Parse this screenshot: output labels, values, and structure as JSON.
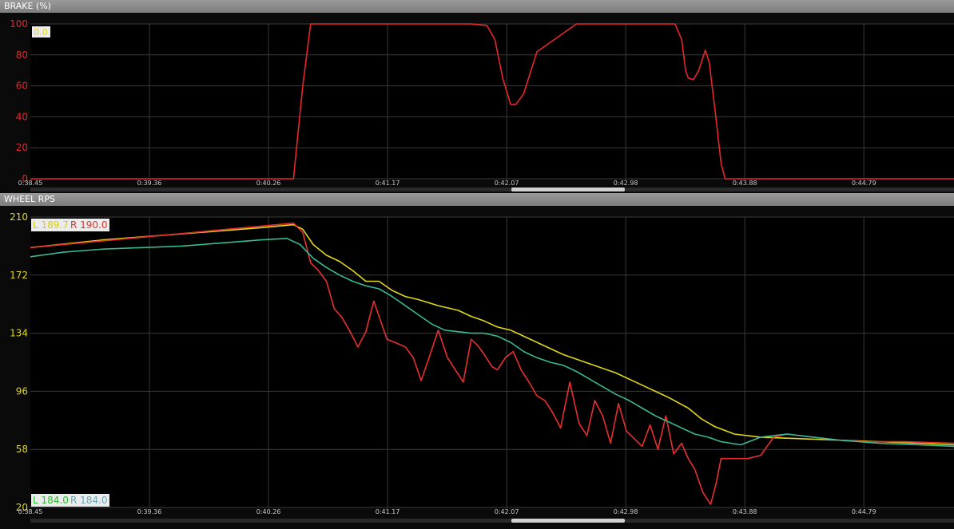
{
  "chart_data": [
    {
      "type": "line",
      "title": "BRAKE (%)",
      "ylim": [
        0,
        100
      ],
      "yticks": [
        "100",
        "80",
        "60",
        "40",
        "20",
        "0"
      ],
      "xticks": [
        "0:38.45",
        "0:39.36",
        "0:40.26",
        "0:41.17",
        "0:42.07",
        "0:42.98",
        "0:43.88",
        "0:44.79"
      ],
      "xlim": [
        38.45,
        45.47
      ],
      "readout": "0.0",
      "series": [
        {
          "color": "#e8262a",
          "x": [
            38.45,
            40.45,
            40.52,
            40.58,
            41.0,
            41.6,
            41.8,
            41.92,
            41.98,
            42.04,
            42.1,
            42.14,
            42.2,
            42.3,
            42.6,
            43.0,
            43.32,
            43.35,
            43.4,
            43.43,
            43.45,
            43.49,
            43.53,
            43.58,
            43.61,
            43.66,
            43.7,
            43.73,
            45.47
          ],
          "y": [
            0,
            0,
            60,
            100,
            100,
            100,
            100,
            99,
            90,
            65,
            48,
            48,
            55,
            82,
            100,
            100,
            100,
            100,
            90,
            70,
            65,
            64,
            70,
            83,
            75,
            40,
            10,
            0,
            0
          ]
        }
      ]
    },
    {
      "type": "line",
      "title": "WHEEL RPS",
      "ylim": [
        20,
        210
      ],
      "yticks": [
        "210",
        "172",
        "134",
        "96",
        "58",
        "20"
      ],
      "xticks": [
        "0:38.45",
        "0:39.36",
        "0:40.26",
        "0:41.17",
        "0:42.07",
        "0:42.98",
        "0:43.88",
        "0:44.79"
      ],
      "xlim": [
        38.45,
        45.47
      ],
      "readout_top": {
        "left": "L 189.7",
        "right": "R 190.0"
      },
      "readout_bottom": {
        "left": "L 184.0",
        "right": "R 184.0"
      },
      "series": [
        {
          "color": "#e0d81a",
          "x": [
            38.45,
            39.0,
            39.6,
            40.2,
            40.45,
            40.52,
            40.6,
            40.7,
            40.8,
            40.9,
            41.0,
            41.1,
            41.2,
            41.3,
            41.4,
            41.55,
            41.7,
            41.8,
            41.9,
            42.0,
            42.1,
            42.2,
            42.35,
            42.5,
            42.7,
            42.9,
            43.1,
            43.3,
            43.45,
            43.55,
            43.65,
            43.8,
            44.0,
            44.3,
            44.6,
            44.9,
            45.2,
            45.47
          ],
          "y": [
            190,
            195,
            199,
            203,
            205,
            202,
            192,
            185,
            181,
            175,
            168,
            168,
            162,
            158,
            156,
            152,
            149,
            145,
            142,
            138,
            136,
            132,
            126,
            120,
            114,
            108,
            100,
            92,
            85,
            78,
            73,
            68,
            66,
            65,
            64,
            63,
            62,
            61
          ]
        },
        {
          "color": "#e83030",
          "x": [
            38.45,
            40.45,
            40.52,
            40.58,
            40.64,
            40.7,
            40.76,
            40.82,
            40.88,
            40.94,
            41.0,
            41.06,
            41.1,
            41.16,
            41.22,
            41.3,
            41.36,
            41.42,
            41.48,
            41.55,
            41.62,
            41.68,
            41.74,
            41.8,
            41.85,
            41.9,
            41.96,
            42.0,
            42.06,
            42.12,
            42.18,
            42.24,
            42.3,
            42.36,
            42.42,
            42.48,
            42.55,
            42.62,
            42.68,
            42.74,
            42.8,
            42.86,
            42.92,
            42.98,
            43.04,
            43.1,
            43.16,
            43.22,
            43.28,
            43.34,
            43.4,
            43.45,
            43.5,
            43.56,
            43.62,
            43.66,
            43.7,
            43.76,
            43.82,
            43.9,
            44.0,
            44.1,
            44.2,
            44.4,
            44.6,
            44.8,
            45.1,
            45.47
          ],
          "y": [
            190,
            206,
            200,
            180,
            175,
            168,
            150,
            144,
            135,
            125,
            135,
            155,
            145,
            130,
            128,
            125,
            118,
            103,
            118,
            136,
            118,
            110,
            102,
            130,
            126,
            120,
            112,
            110,
            118,
            122,
            110,
            102,
            93,
            90,
            82,
            72,
            102,
            75,
            67,
            90,
            80,
            62,
            88,
            70,
            65,
            60,
            74,
            58,
            80,
            55,
            62,
            52,
            45,
            30,
            22,
            35,
            52,
            52,
            52,
            52,
            54,
            66,
            68,
            66,
            64,
            63,
            63,
            62
          ]
        },
        {
          "color": "#3ab893",
          "x": [
            38.45,
            38.7,
            39.0,
            39.3,
            39.6,
            39.9,
            40.2,
            40.4,
            40.5,
            40.6,
            40.7,
            40.8,
            40.9,
            41.0,
            41.1,
            41.2,
            41.3,
            41.4,
            41.5,
            41.6,
            41.7,
            41.8,
            41.9,
            42.0,
            42.1,
            42.2,
            42.3,
            42.4,
            42.5,
            42.6,
            42.7,
            42.8,
            42.9,
            43.0,
            43.1,
            43.2,
            43.3,
            43.4,
            43.5,
            43.6,
            43.7,
            43.85,
            44.0,
            44.2,
            44.4,
            44.6,
            44.9,
            45.2,
            45.47
          ],
          "y": [
            184,
            187,
            189,
            190,
            191,
            193,
            195,
            196,
            192,
            183,
            177,
            172,
            168,
            165,
            163,
            158,
            152,
            146,
            140,
            136,
            135,
            134,
            134,
            132,
            128,
            122,
            118,
            115,
            113,
            109,
            104,
            99,
            94,
            90,
            85,
            80,
            76,
            72,
            68,
            66,
            63,
            61,
            66,
            68,
            66,
            64,
            62,
            61,
            60
          ]
        }
      ]
    }
  ]
}
